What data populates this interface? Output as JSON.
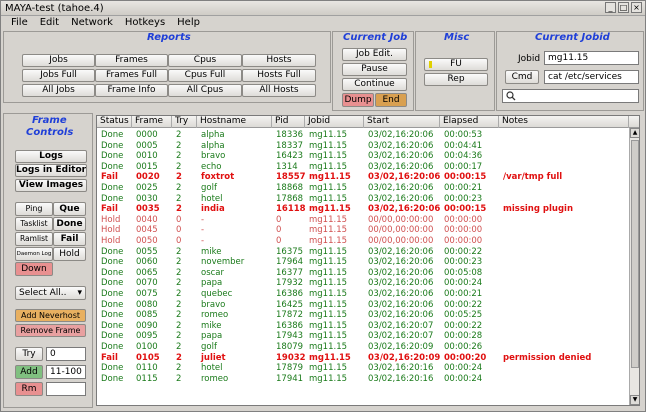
{
  "window": {
    "title": "MAYA-test (tahoe.4)"
  },
  "menu": [
    "File",
    "Edit",
    "Network",
    "Hotkeys",
    "Help"
  ],
  "reports": {
    "title": "Reports",
    "buttons": [
      "Jobs",
      "Frames",
      "Cpus",
      "Hosts",
      "Jobs Full",
      "Frames Full",
      "Cpus Full",
      "Hosts Full",
      "All Jobs",
      "Frame Info",
      "All Cpus",
      "All Hosts"
    ]
  },
  "current_job": {
    "title": "Current Job",
    "job_edit": "Job Edit.",
    "pause": "Pause",
    "continue": "Continue",
    "dump": "Dump",
    "end": "End"
  },
  "misc": {
    "title": "Misc",
    "fu": "FU",
    "rep": "Rep"
  },
  "current_jobid": {
    "title": "Current Jobid",
    "jobid_label": "Jobid",
    "jobid_value": "mg11.15",
    "cmd_label": "Cmd",
    "cmd_value": "cat /etc/services",
    "search_value": ""
  },
  "frame_controls": {
    "title_line1": "Frame",
    "title_line2": "Controls",
    "logs": "Logs",
    "logs_editor": "Logs in Editor",
    "view_images": "View Images",
    "ping": "Ping",
    "que": "Que",
    "tasklist": "Tasklist",
    "done": "Done",
    "ramlist": "Ramlist",
    "fail": "Fail",
    "daemon_log": "Daemon Log",
    "hold": "Hold",
    "down": "Down",
    "select_all": "Select All..",
    "add_neverhost": "Add Neverhost",
    "remove_frame": "Remove Frame",
    "try": "Try",
    "try_value": "0",
    "add": "Add",
    "add_value": "11-100",
    "rm": "Rm",
    "rm_value": ""
  },
  "table": {
    "columns": [
      "Status",
      "Frame",
      "Try",
      "Hostname",
      "Pid",
      "Jobid",
      "Start",
      "Elapsed",
      "Notes"
    ],
    "rows": [
      [
        "Done",
        "0000",
        "2",
        "alpha",
        "18336",
        "mg11.15",
        "03/02,16:20:06",
        "00:00:53",
        "",
        "done"
      ],
      [
        "Done",
        "0005",
        "2",
        "alpha",
        "18337",
        "mg11.15",
        "03/02,16:20:06",
        "00:04:41",
        "",
        "done"
      ],
      [
        "Done",
        "0010",
        "2",
        "bravo",
        "16423",
        "mg11.15",
        "03/02,16:20:06",
        "00:04:36",
        "",
        "done"
      ],
      [
        "Done",
        "0015",
        "2",
        "echo",
        "1314",
        "mg11.15",
        "03/02,16:20:06",
        "00:00:17",
        "",
        "done"
      ],
      [
        "Fail",
        "0020",
        "2",
        "foxtrot",
        "18557",
        "mg11.15",
        "03/02,16:20:06",
        "00:00:15",
        "/var/tmp full",
        "fail"
      ],
      [
        "Done",
        "0025",
        "2",
        "golf",
        "18868",
        "mg11.15",
        "03/02,16:20:06",
        "00:00:21",
        "",
        "done"
      ],
      [
        "Done",
        "0030",
        "2",
        "hotel",
        "17868",
        "mg11.15",
        "03/02,16:20:06",
        "00:00:23",
        "",
        "done"
      ],
      [
        "Fail",
        "0035",
        "2",
        "india",
        "16118",
        "mg11.15",
        "03/02,16:20:06",
        "00:00:15",
        "missing plugin",
        "fail"
      ],
      [
        "Hold",
        "0040",
        "0",
        "-",
        "0",
        "mg11.15",
        "00/00,00:00:00",
        "00:00:00",
        "",
        "hold"
      ],
      [
        "Hold",
        "0045",
        "0",
        "-",
        "0",
        "mg11.15",
        "00/00,00:00:00",
        "00:00:00",
        "",
        "hold"
      ],
      [
        "Hold",
        "0050",
        "0",
        "-",
        "0",
        "mg11.15",
        "00/00,00:00:00",
        "00:00:00",
        "",
        "hold"
      ],
      [
        "Done",
        "0055",
        "2",
        "mike",
        "16375",
        "mg11.15",
        "03/02,16:20:06",
        "00:00:22",
        "",
        "done"
      ],
      [
        "Done",
        "0060",
        "2",
        "november",
        "17964",
        "mg11.15",
        "03/02,16:20:06",
        "00:00:23",
        "",
        "done"
      ],
      [
        "Done",
        "0065",
        "2",
        "oscar",
        "16377",
        "mg11.15",
        "03/02,16:20:06",
        "00:05:08",
        "",
        "done"
      ],
      [
        "Done",
        "0070",
        "2",
        "papa",
        "17932",
        "mg11.15",
        "03/02,16:20:06",
        "00:00:24",
        "",
        "done"
      ],
      [
        "Done",
        "0075",
        "2",
        "quebec",
        "16386",
        "mg11.15",
        "03/02,16:20:06",
        "00:00:21",
        "",
        "done"
      ],
      [
        "Done",
        "0080",
        "2",
        "bravo",
        "16425",
        "mg11.15",
        "03/02,16:20:06",
        "00:00:22",
        "",
        "done"
      ],
      [
        "Done",
        "0085",
        "2",
        "romeo",
        "17872",
        "mg11.15",
        "03/02,16:20:06",
        "00:05:25",
        "",
        "done"
      ],
      [
        "Done",
        "0090",
        "2",
        "mike",
        "16386",
        "mg11.15",
        "03/02,16:20:07",
        "00:00:22",
        "",
        "done"
      ],
      [
        "Done",
        "0095",
        "2",
        "papa",
        "17943",
        "mg11.15",
        "03/02,16:20:07",
        "00:00:28",
        "",
        "done"
      ],
      [
        "Done",
        "0100",
        "2",
        "golf",
        "18079",
        "mg11.15",
        "03/02,16:20:09",
        "00:00:26",
        "",
        "done"
      ],
      [
        "Fail",
        "0105",
        "2",
        "juliet",
        "19032",
        "mg11.15",
        "03/02,16:20:09",
        "00:00:20",
        "permission denied",
        "fail"
      ],
      [
        "Done",
        "0110",
        "2",
        "hotel",
        "17879",
        "mg11.15",
        "03/02,16:20:16",
        "00:00:24",
        "",
        "done"
      ],
      [
        "Done",
        "0115",
        "2",
        "romeo",
        "17941",
        "mg11.15",
        "03/02,16:20:16",
        "00:00:24",
        "",
        "done"
      ]
    ]
  },
  "colors": {
    "title_blue": "#1f3fd8",
    "done_green": "#1a7a1a",
    "fail_red": "#e01010",
    "hold_red": "#d05050",
    "dump_pink": "#e89090",
    "end_orange": "#d9a050",
    "add_green": "#80c080",
    "remove_pink": "#e8a0a0",
    "add_neverhost_orange": "#e8b060"
  }
}
